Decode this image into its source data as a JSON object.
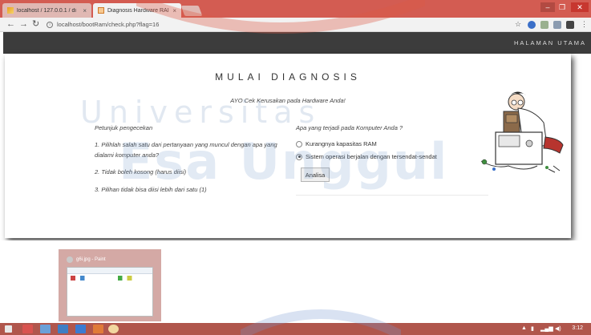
{
  "browser": {
    "tabs": [
      {
        "title": "localhost / 127.0.0.1 / di",
        "active": false
      },
      {
        "title": "Diagnosis Hardware RAI",
        "active": true
      }
    ],
    "url": "localhost/bootRam/check.php?flag=16"
  },
  "site": {
    "nav_home": "HALAMAN UTAMA",
    "title": "MULAI DIAGNOSIS",
    "subtitle": "AYO Cek Kerusakan pada Hardware Anda!",
    "instructions": {
      "heading": "Petunjuk pengecekan",
      "items": [
        "1. Pilihlah salah satu dari pertanyaan yang muncul dengan apa yang dialami komputer anda?",
        "2. Tidak boleh kosong (harus diisi)",
        "3. Pilihan tidak bisa diisi lebih dari satu (1)"
      ]
    },
    "question": {
      "heading": "Apa yang terjadi pada Komputer Anda ?",
      "options": [
        {
          "label": "Kurangnya kapasitas RAM",
          "checked": false
        },
        {
          "label": "Sistem operasi berjalan dengan tersendat-sendat",
          "checked": true
        }
      ],
      "submit_label": "Analisa"
    }
  },
  "watermark": {
    "line1": "Universitas",
    "line2": "Esa Unggul"
  },
  "desktop": {
    "thumbnail_title": "g6i.jpg - Paint"
  },
  "taskbar": {
    "time": "3:12"
  },
  "colors": {
    "browser_frame": "#d35c52",
    "site_nav": "#3c3c3c",
    "taskbar": "#b0564c"
  }
}
